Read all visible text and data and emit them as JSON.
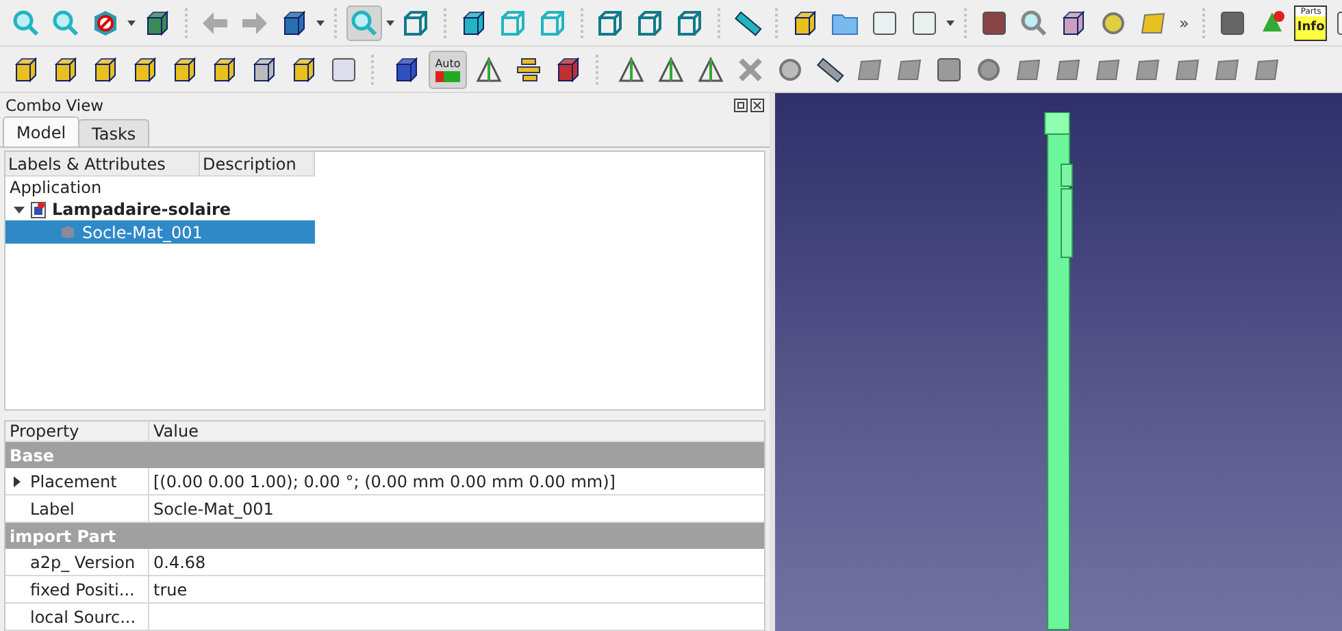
{
  "toolbar": {
    "auto_label": "Auto",
    "overflow": "»",
    "parts_info": {
      "top": "Parts",
      "main": "Info"
    }
  },
  "combo_view": {
    "title": "Combo View",
    "tabs": [
      {
        "label": "Model",
        "selected": true
      },
      {
        "label": "Tasks",
        "selected": false
      }
    ],
    "tree": {
      "columns": [
        "Labels & Attributes",
        "Description"
      ],
      "root": "Application",
      "items": [
        {
          "label": "Lampadaire-solaire",
          "expanded": true,
          "selected": false,
          "children": [
            {
              "label": "Socle-Mat_001",
              "selected": true
            }
          ]
        }
      ]
    },
    "properties": {
      "columns": [
        "Property",
        "Value"
      ],
      "rows": [
        {
          "kind": "group",
          "name": "Base"
        },
        {
          "kind": "property",
          "name": "Placement",
          "value": "[(0.00 0.00 1.00); 0.00 °; (0.00 mm  0.00 mm  0.00 mm)]",
          "expandable": true
        },
        {
          "kind": "property",
          "name": "Label",
          "value": "Socle-Mat_001",
          "expandable": false
        },
        {
          "kind": "group",
          "name": "import Part"
        },
        {
          "kind": "property",
          "name": "a2p_ Version",
          "value": "0.4.68",
          "expandable": false
        },
        {
          "kind": "property",
          "name": "fixed Positi...",
          "value": "true",
          "expandable": false
        },
        {
          "kind": "property",
          "name": "local Sourc...",
          "value": "",
          "expandable": false
        }
      ]
    }
  }
}
